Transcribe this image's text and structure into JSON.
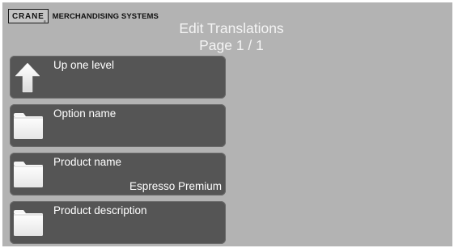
{
  "brand": {
    "logo_word": "CRANE",
    "logo_mark": "®",
    "company": "MERCHANDISING SYSTEMS"
  },
  "header": {
    "title": "Edit Translations",
    "page_indicator": "Page 1 / 1"
  },
  "menu": {
    "items": [
      {
        "icon": "arrow-up-icon",
        "label": "Up one level",
        "value": ""
      },
      {
        "icon": "folder-icon",
        "label": "Option name",
        "value": ""
      },
      {
        "icon": "folder-icon",
        "label": "Product name",
        "value": "Espresso Premium"
      },
      {
        "icon": "folder-icon",
        "label": "Product description",
        "value": ""
      }
    ]
  },
  "colors": {
    "background": "#b3b3b3",
    "item_background": "#555555",
    "text": "#ffffff"
  }
}
